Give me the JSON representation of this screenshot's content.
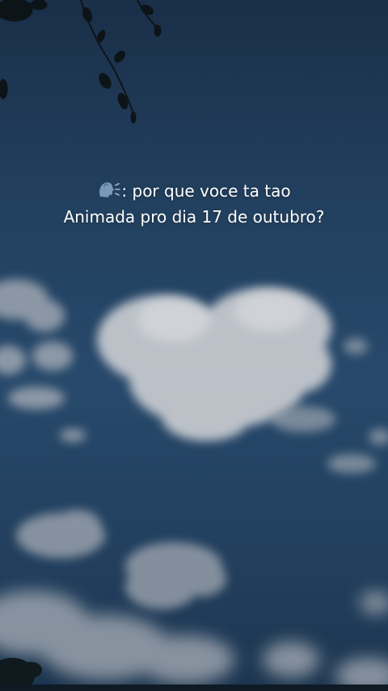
{
  "caption": {
    "icon": "speaking-head-icon",
    "line1": ": por que voce ta tao",
    "line2": "Animada pro dia 17 de outubro?"
  },
  "colors": {
    "sky_top": "#1a2f48",
    "sky_mid": "#27496b",
    "cloud": "#cfd2d6",
    "text": "#ffffff"
  }
}
